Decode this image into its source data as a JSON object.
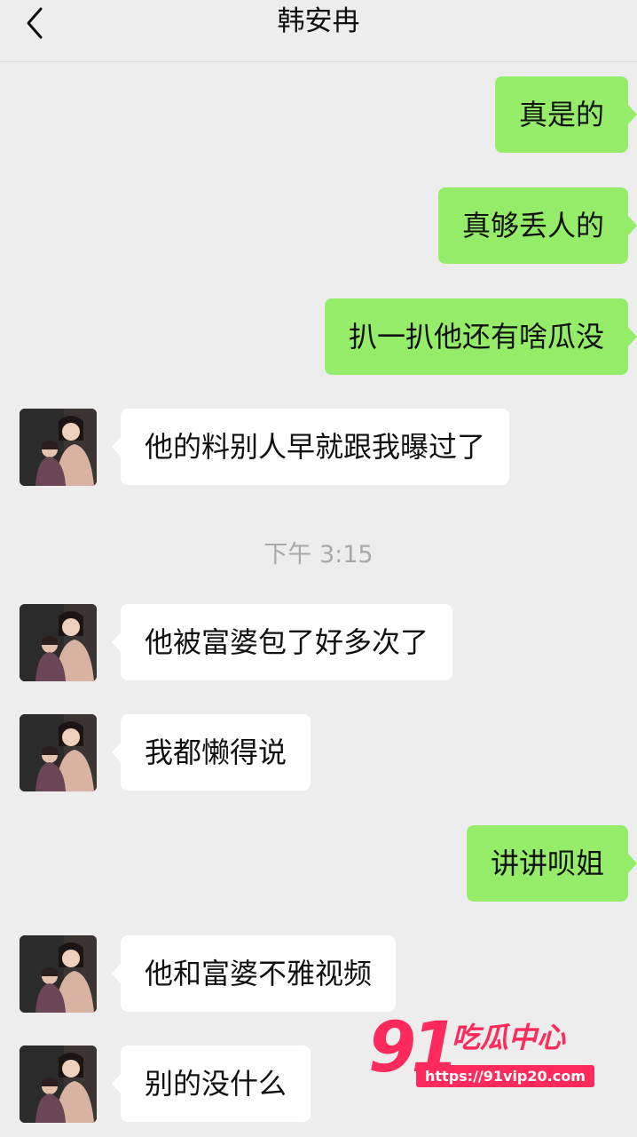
{
  "header": {
    "title": "韩安冉",
    "back_icon": "chevron-left-icon"
  },
  "colors": {
    "background": "#ededed",
    "sent_bubble": "#95ec69",
    "received_bubble": "#ffffff",
    "timestamp": "#a8a8a8",
    "watermark": "#ff2a5c"
  },
  "messages": [
    {
      "side": "right",
      "text": "真是的"
    },
    {
      "side": "right",
      "text": "真够丢人的"
    },
    {
      "side": "right",
      "text": "扒一扒他还有啥瓜没"
    },
    {
      "side": "left",
      "text": "他的料别人早就跟我曝过了"
    },
    {
      "type": "time",
      "text": "下午 3:15"
    },
    {
      "side": "left",
      "text": "他被富婆包了好多次了"
    },
    {
      "side": "left",
      "text": "我都懒得说"
    },
    {
      "side": "right",
      "text": "讲讲呗姐"
    },
    {
      "side": "left",
      "text": "他和富婆不雅视频"
    },
    {
      "side": "left",
      "text": "别的没什么"
    }
  ],
  "watermark": {
    "number": "91",
    "name": "吃瓜中心",
    "url": "https://91vip20.com"
  }
}
